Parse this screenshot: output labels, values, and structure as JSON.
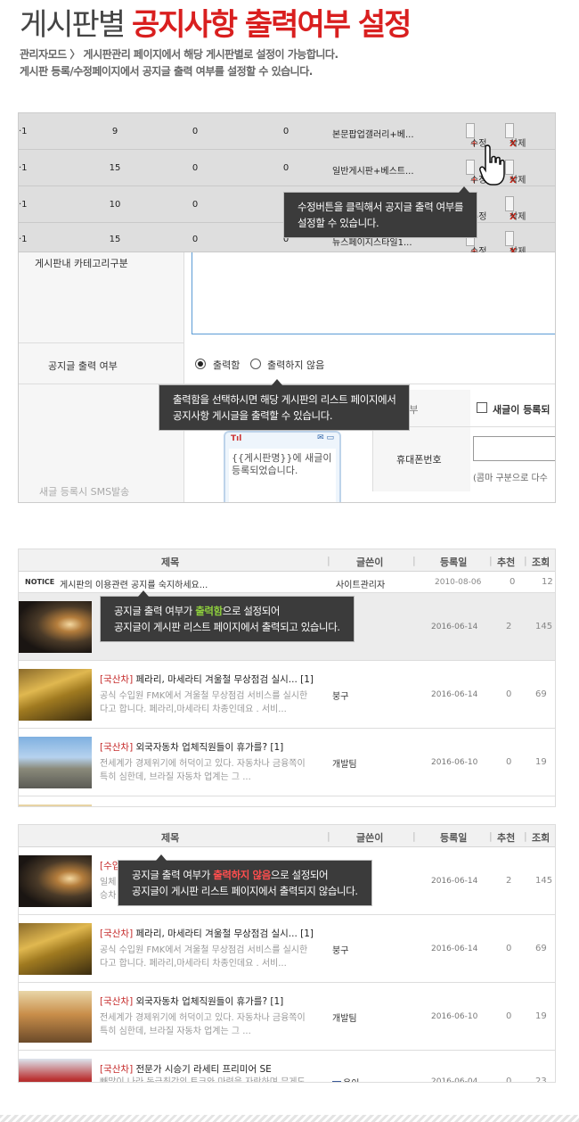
{
  "header": {
    "title_prefix": "게시판별",
    "title_highlight": "공지사항 출력여부 설정",
    "desc_line1": "관리자모드 〉 게시판관리 페이지에서 해당 게시판별로 설정이 가능합니다.",
    "desc_line2": "게시판 등록/수정페이지에서 공지글 출력 여부를 설정할 수 있습니다."
  },
  "board_rows": [
    {
      "name": "·1",
      "a": "9",
      "b": "0",
      "c": "0",
      "skin": "본문팝업갤러리+베..."
    },
    {
      "name": "·1",
      "a": "15",
      "b": "0",
      "c": "0",
      "skin": "일반게시판+베스트..."
    },
    {
      "name": "·1",
      "a": "10",
      "b": "0",
      "c": "0",
      "skin": ""
    },
    {
      "name": "·1",
      "a": "15",
      "b": "0",
      "c": "0",
      "skin": "뉴스페이지스타일1..."
    }
  ],
  "buttons": {
    "edit": "수정",
    "edit_plus": "+",
    "delete": "삭제",
    "delete_x": "X"
  },
  "tooltips": {
    "edit_tip_line1": "수정버튼을 클릭해서 공지글 출력 여부를",
    "edit_tip_line2": "설정할 수 있습니다.",
    "output_tip_line1": "출력함을 선택하시면 해당 게시판의 리스트 페이지에서",
    "output_tip_line2": "공지사항 게시글을 출력할 수 있습니다.",
    "on_tip_a": "공지글 출력 여부가 ",
    "on_tip_hl": "출력함",
    "on_tip_b": "으로 설정되어",
    "on_tip_line2": "공지글이 게시판 리스트 페이지에서 출력되고 있습니다.",
    "off_tip_a": "공지글 출력 여부가 ",
    "off_tip_hl": "출력하지 않음",
    "off_tip_b": "으로 설정되어",
    "off_tip_line2": "공지글이 게시판 리스트 페이지에서 출력되지 않습니다."
  },
  "form": {
    "category_label": "게시판내 카테고리구분",
    "notice_label": "공지글 출력 여부",
    "opt_on": "출력함",
    "opt_off": "출력하지 않음",
    "sms_label": "새글 등록시 SMS발송",
    "send_label": "발송여부",
    "new_post_label": "새글이 등록되",
    "phone_label": "휴대폰번호",
    "phone_hint": "(콤마 구분으로 다수",
    "phone_preview": "{{게시판명}}에 새글이 등록되었습니다."
  },
  "list_header": {
    "title": "제목",
    "writer": "글쓴이",
    "date": "등록일",
    "rec": "추천",
    "view": "조회"
  },
  "notice_post": {
    "badge": "NOTICE",
    "title": "게시판의 이용관련 공지를 숙지하세요...",
    "writer": "사이트관리자",
    "date": "2010-08-06",
    "rec": "0",
    "view": "12"
  },
  "list1": [
    {
      "cat": "",
      "title": "",
      "body1": "",
      "body2": "",
      "writer": "",
      "date": "2016-06-14",
      "rec": "2",
      "view": "145"
    },
    {
      "cat": "[국산차]",
      "title": " 페라리, 마세라티 겨울철 무상점검 실시... [1]",
      "body1": "공식 수입원 FMK에서 겨울철 무상점검 서비스를 실시한",
      "body2": "다고 합니다. 페라리,마세라티 차종인데요 . 서비...",
      "writer": "붕구",
      "date": "2016-06-14",
      "rec": "0",
      "view": "69"
    },
    {
      "cat": "[국산차]",
      "title": " 외국자동차 업체직원들이 휴가를? [1]",
      "body1": "전세계가 경제위기에 허덕이고 있다.  자동차나 금융쪽이",
      "body2": "특히 심한데, 브라질 자동차 업계는 그 ...",
      "writer": "개발팀",
      "date": "2016-06-10",
      "rec": "0",
      "view": "19"
    }
  ],
  "list2": [
    {
      "cat": "[수입",
      "title": "",
      "body1": "일체",
      "body2": "승차",
      "writer": "",
      "date": "2016-06-14",
      "rec": "2",
      "view": "145"
    },
    {
      "cat": "[국산차]",
      "title": " 페라리, 마세라티 겨울철 무상점검 실시... [1]",
      "body1": "공식 수입원 FMK에서 겨울철 무상점검 서비스를 실시한",
      "body2": "다고 합니다. 페라리,마세라티 차종인데요 . 서비...",
      "writer": "붕구",
      "date": "2016-06-14",
      "rec": "0",
      "view": "69"
    },
    {
      "cat": "[국산차]",
      "title": " 외국자동차 업체직원들이 휴가를? [1]",
      "body1": "전세계가 경제위기에 허덕이고 있다.  자동차나 금융쪽이",
      "body2": "특히 심한데, 브라질 자동차 업계는 그 ...",
      "writer": "개발팀",
      "date": "2016-06-10",
      "rec": "0",
      "view": "19"
    },
    {
      "cat": "[국산차]",
      "title": " 전문가 시승기 라세티 프리미어 SE",
      "body1": "빼많이 나라 동급최강의 토크와 마력을 자랑하며 무게도",
      "body2": "",
      "writer": "용이",
      "date": "2016-06-04",
      "rec": "0",
      "view": "23"
    }
  ]
}
